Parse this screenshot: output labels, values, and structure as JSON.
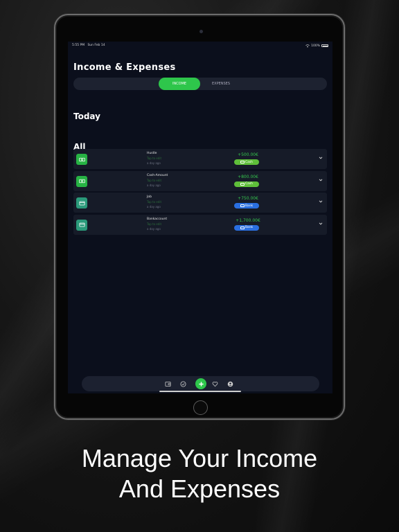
{
  "status_bar": {
    "time": "5:55 PM",
    "date": "Sun Feb 14",
    "battery": "100%"
  },
  "app": {
    "title": "Income & Expenses",
    "tabs": [
      {
        "label": "INCOME",
        "active": true
      },
      {
        "label": "EXPENSES",
        "active": false
      }
    ],
    "sections": {
      "today": "Today",
      "all": "All"
    },
    "entries": [
      {
        "name": "Hustle",
        "sub": "Tap to edit",
        "time": "a day ago",
        "amount": "+500.00€",
        "method": "Cash",
        "method_color": "#5fbf3a",
        "icon": "cash-icon",
        "icon_color": "#27b344"
      },
      {
        "name": "Cash-Amount",
        "sub": "Tap to edit",
        "time": "a day ago",
        "amount": "+800.00€",
        "method": "Cash",
        "method_color": "#5fbf3a",
        "icon": "cash-icon",
        "icon_color": "#27b344"
      },
      {
        "name": "Job",
        "sub": "Tap to edit",
        "time": "a day ago",
        "amount": "+750.00€",
        "method": "Bank",
        "method_color": "#2a6fe0",
        "icon": "card-icon",
        "icon_color": "#2a9a7a"
      },
      {
        "name": "Bankaccount",
        "sub": "Tap to edit",
        "time": "a day ago",
        "amount": "+1,700.00€",
        "method": "Bank",
        "method_color": "#2a6fe0",
        "icon": "card-icon",
        "icon_color": "#2a9a7a"
      }
    ],
    "bottom_nav": [
      "wallet-icon",
      "check-circle-icon",
      "add-icon",
      "heart-icon",
      "profile-icon"
    ],
    "accent_color": "#2ec64b"
  },
  "tagline": {
    "line1": "Manage Your Income",
    "line2": "And Expenses"
  }
}
